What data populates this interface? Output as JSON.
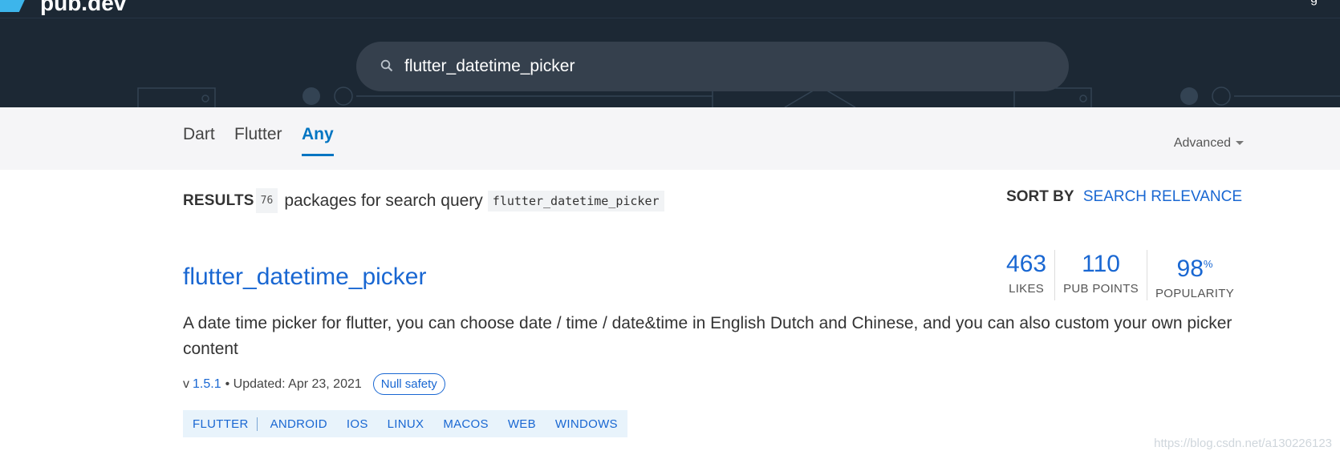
{
  "header": {
    "logo_text": "pub.dev",
    "top_right_glyph": "g",
    "search": {
      "value": "flutter_datetime_picker",
      "icon": "search-icon"
    }
  },
  "tabs": [
    {
      "label": "Dart",
      "active": false
    },
    {
      "label": "Flutter",
      "active": false
    },
    {
      "label": "Any",
      "active": true
    }
  ],
  "advanced_label": "Advanced",
  "results": {
    "label": "RESULTS",
    "count": "76",
    "text": "packages for search query",
    "query": "flutter_datetime_picker"
  },
  "sort": {
    "label": "SORT BY",
    "value": "SEARCH RELEVANCE"
  },
  "package": {
    "title": "flutter_datetime_picker",
    "description": "A date time picker for flutter, you can choose date / time / date&time in English Dutch and Chinese, and you can also custom your own picker content",
    "metrics": [
      {
        "value": "463",
        "suffix": "",
        "label": "LIKES"
      },
      {
        "value": "110",
        "suffix": "",
        "label": "PUB POINTS"
      },
      {
        "value": "98",
        "suffix": "%",
        "label": "POPULARITY"
      }
    ],
    "version_prefix": "v",
    "version": "1.5.1",
    "updated": "• Updated: Apr 23, 2021",
    "null_safety": "Null safety",
    "tags": [
      "FLUTTER",
      "ANDROID",
      "IOS",
      "LINUX",
      "MACOS",
      "WEB",
      "WINDOWS"
    ]
  },
  "watermark": "https://blog.csdn.net/a130226123",
  "colors": {
    "header_bg": "#1c2834",
    "accent": "#1967d2",
    "tab_accent": "#0175c2"
  }
}
